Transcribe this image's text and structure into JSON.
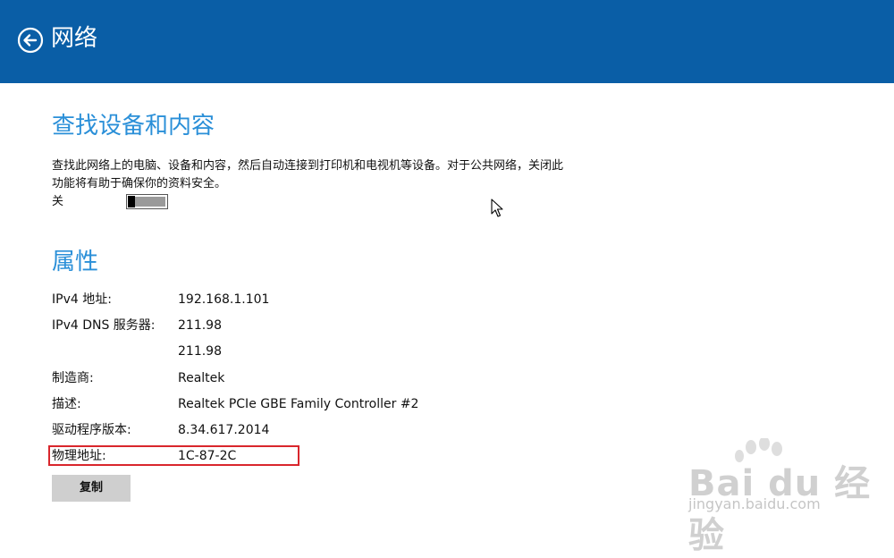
{
  "header": {
    "title": "网络",
    "back_icon": "back-arrow-icon",
    "bg_color": "#0a5ea6"
  },
  "discovery": {
    "title": "查找设备和内容",
    "description": "查找此网络上的电脑、设备和内容，然后自动连接到打印机和电视机等设备。对于公共网络，关闭此功能将有助于确保你的资料安全。",
    "toggle_label": "关",
    "toggle_state": "off"
  },
  "properties": {
    "title": "属性",
    "rows": [
      {
        "key": "IPv4 地址:",
        "value": "192.168.1.101"
      },
      {
        "key": "IPv4 DNS 服务器:",
        "value": "211.98"
      },
      {
        "key": "",
        "value": "211.98"
      },
      {
        "key": "制造商:",
        "value": "Realtek"
      },
      {
        "key": "描述:",
        "value": "Realtek PCIe GBE Family Controller #2"
      },
      {
        "key": "驱动程序版本:",
        "value": "8.34.617.2014"
      },
      {
        "key": "物理地址:",
        "value": "1C-87-2C"
      }
    ],
    "copy_label": "复制"
  },
  "watermark": {
    "brand": "Bai du 经验",
    "url": "jingyan.baidu.com"
  },
  "colors": {
    "accent": "#2a8fd8",
    "highlight": "#d9262c"
  }
}
